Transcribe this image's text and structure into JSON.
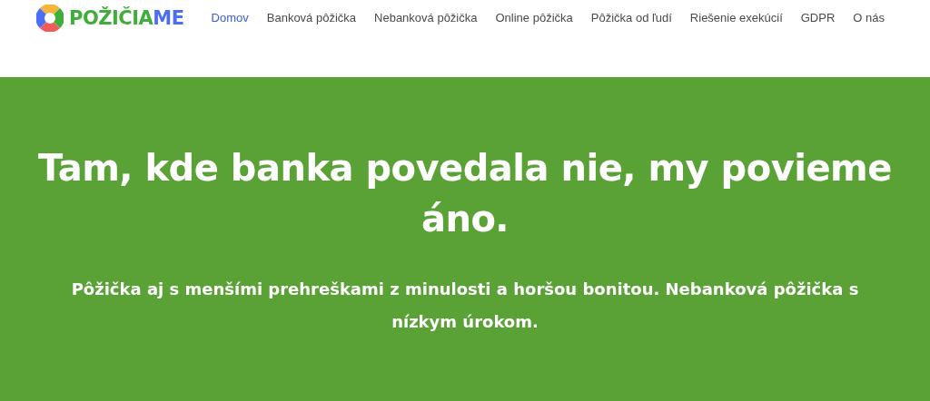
{
  "logo": {
    "parts": [
      {
        "text": "POŽIČIA",
        "color": "#3fae3a"
      },
      {
        "text": "ME",
        "color": "#4b6ef5"
      }
    ]
  },
  "nav": [
    {
      "label": "Domov",
      "selected": true
    },
    {
      "label": "Banková pôžička",
      "selected": false
    },
    {
      "label": "Nebanková pôžička",
      "selected": false
    },
    {
      "label": "Online pôžička",
      "selected": false
    },
    {
      "label": "Pôžička od ľudí",
      "selected": false
    },
    {
      "label": "Riešenie exekúcií",
      "selected": false
    },
    {
      "label": "GDPR",
      "selected": false
    },
    {
      "label": "O nás",
      "selected": false
    }
  ],
  "hero": {
    "heading": "Tam, kde banka povedala nie, my povieme áno.",
    "subheading": "Pôžička aj s menšími prehreškami z minulosti a horšou bonitou. Nebanková pôžička s nízkym úrokom."
  }
}
